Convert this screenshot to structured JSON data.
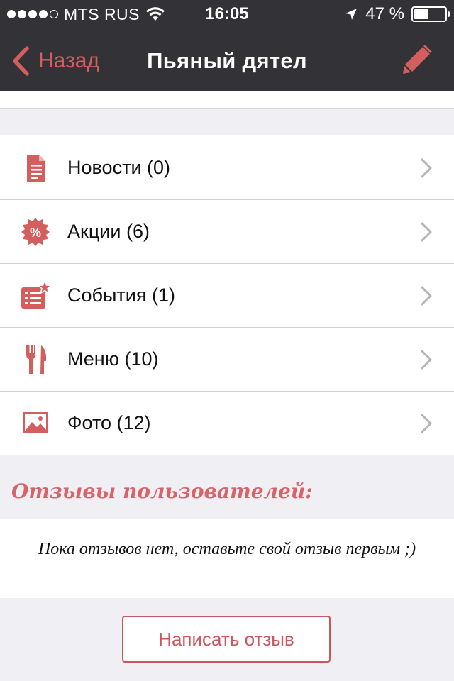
{
  "status_bar": {
    "carrier": "MTS RUS",
    "time": "16:05",
    "battery_text": "47 %",
    "battery_level": 0.47
  },
  "nav": {
    "back_label": "Назад",
    "title": "Пьяный дятел",
    "accent_color": "#d35e5e"
  },
  "menu": {
    "items": [
      {
        "label": "Новости (0)",
        "icon": "news-document-icon"
      },
      {
        "label": "Акции (6)",
        "icon": "discount-percent-icon"
      },
      {
        "label": "События (1)",
        "icon": "events-star-icon"
      },
      {
        "label": "Меню (10)",
        "icon": "fork-knife-icon"
      },
      {
        "label": "Фото (12)",
        "icon": "photo-image-icon"
      }
    ]
  },
  "reviews": {
    "heading": "Отзывы пользователей:",
    "empty_text": "Пока отзывов нет, оставьте свой отзыв первым ;)",
    "write_button": "Написать отзыв"
  }
}
